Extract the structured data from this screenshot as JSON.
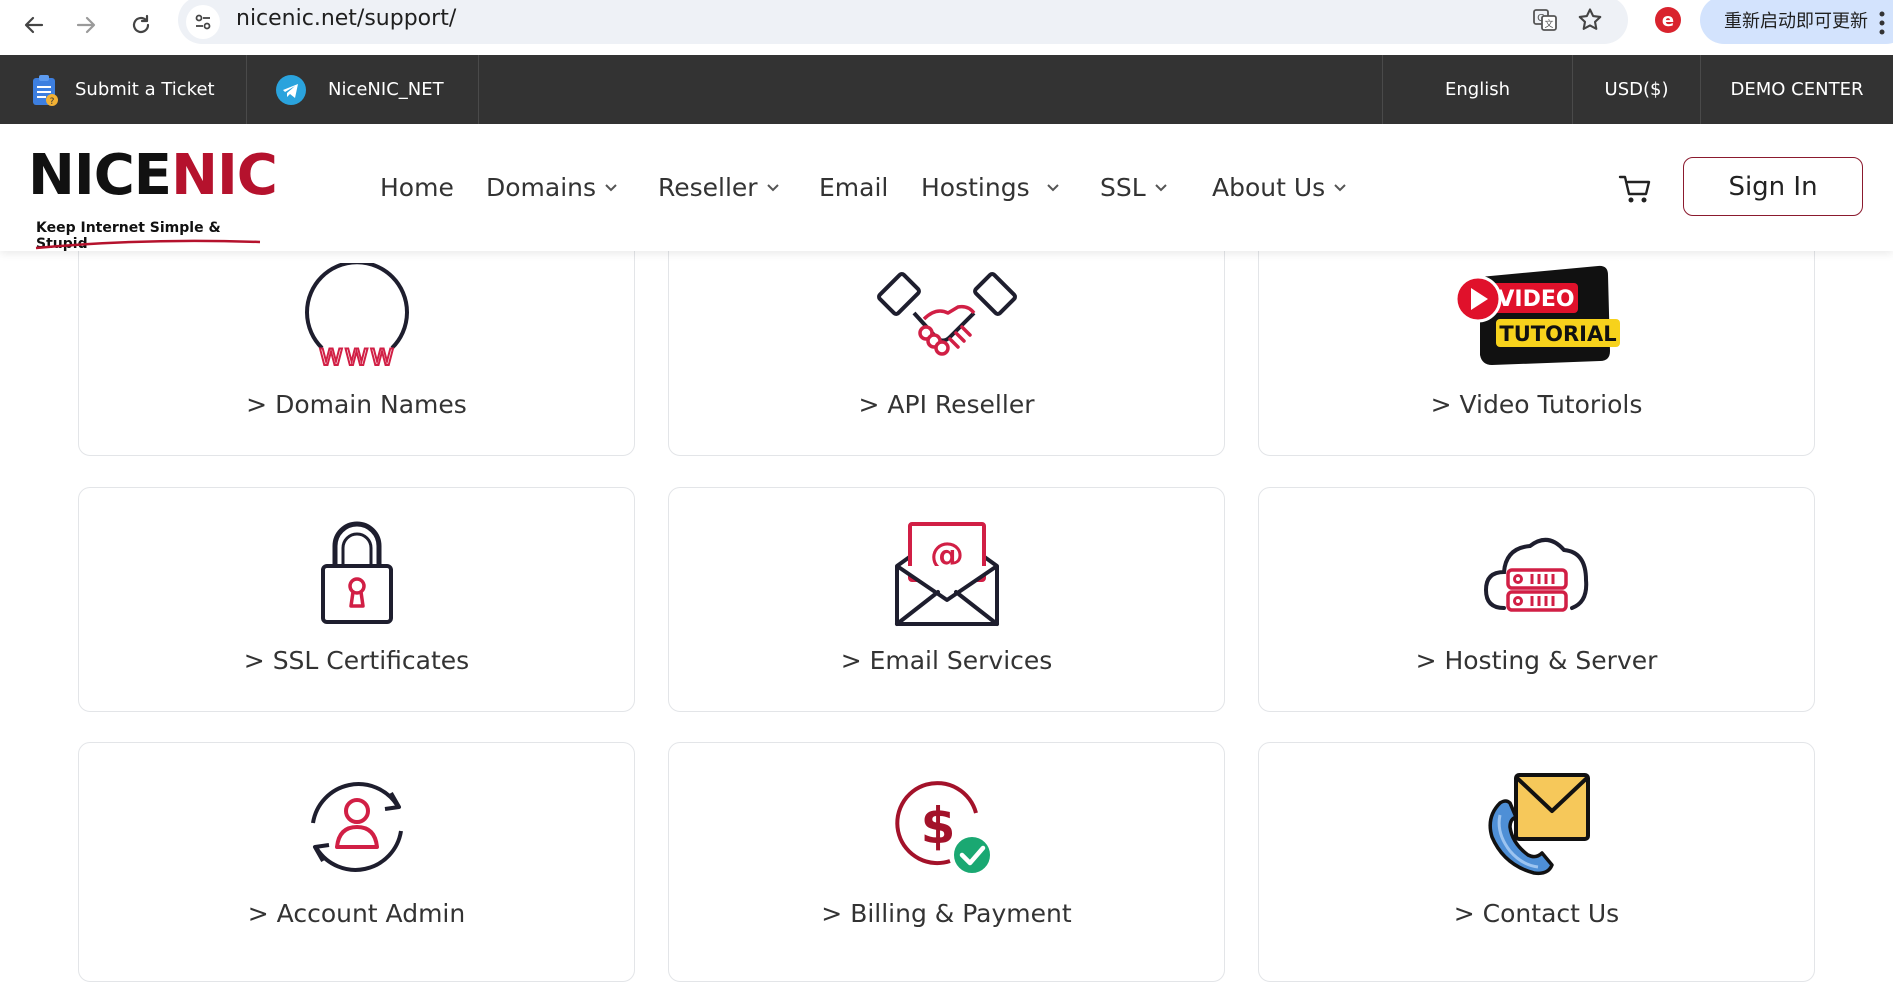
{
  "browser": {
    "url": "nicenic.net/support/",
    "update_button": "重新启动即可更新"
  },
  "topbar": {
    "submit_ticket": "Submit a Ticket",
    "telegram": "NiceNIC_NET",
    "language": "English",
    "currency": "USD($)",
    "demo_center": "DEMO CENTER"
  },
  "header": {
    "logo_text_black_1": "NICE",
    "logo_text_red": "N",
    "logo_text_black_2": "IC",
    "logo_tagline": "Keep Internet Simple & Stupid",
    "nav": {
      "home": "Home",
      "domains": "Domains",
      "reseller": "Reseller",
      "email": "Email",
      "hostings": "Hostings",
      "ssl": "SSL",
      "about": "About Us"
    },
    "sign_in": "Sign In"
  },
  "cards": [
    {
      "label": "> Domain Names",
      "icon": "www-globe-icon",
      "icon_text": "www"
    },
    {
      "label": "> API Reseller",
      "icon": "handshake-icon"
    },
    {
      "label": "> Video Tutoriols",
      "icon": "video-tutorial-icon",
      "icon_text_1": "VIDEO",
      "icon_text_2": "TUTORIAL"
    },
    {
      "label": "> SSL Certificates",
      "icon": "padlock-icon"
    },
    {
      "label": "> Email Services",
      "icon": "envelope-icon",
      "icon_text": "@"
    },
    {
      "label": "> Hosting & Server",
      "icon": "cloud-server-icon"
    },
    {
      "label": "> Account Admin",
      "icon": "account-cycle-icon"
    },
    {
      "label": "> Billing & Payment",
      "icon": "dollar-check-icon",
      "icon_text": "$"
    },
    {
      "label": "> Contact Us",
      "icon": "phone-mail-icon"
    }
  ],
  "colors": {
    "brand_red": "#b5122d",
    "dark_bar": "#333333",
    "icon_navy": "#1e1e2e"
  }
}
